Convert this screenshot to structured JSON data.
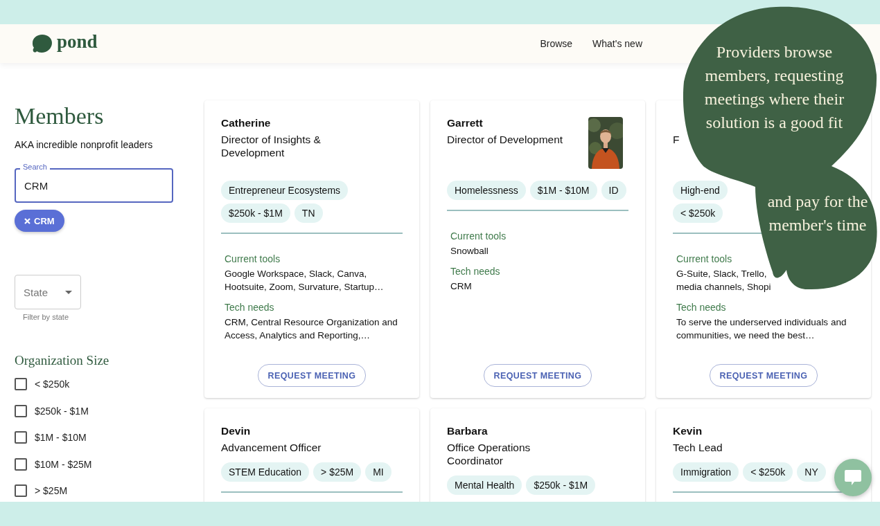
{
  "header": {
    "logo": "pond",
    "nav": [
      {
        "label": "Browse"
      },
      {
        "label": "What's new"
      }
    ]
  },
  "sidebar": {
    "title": "Members",
    "subtitle": "AKA incredible nonprofit leaders",
    "search": {
      "label": "Search",
      "value": "CRM"
    },
    "chips": [
      {
        "label": "CRM"
      }
    ],
    "state_filter": {
      "placeholder": "State",
      "helper": "Filter by state"
    },
    "org_size": {
      "title": "Organization Size",
      "options": [
        {
          "label": "< $250k",
          "checked": false
        },
        {
          "label": "$250k - $1M",
          "checked": false
        },
        {
          "label": "$1M - $10M",
          "checked": false
        },
        {
          "label": "$10M - $25M",
          "checked": false
        },
        {
          "label": "> $25M",
          "checked": false
        }
      ]
    }
  },
  "members": [
    {
      "name": "Catherine",
      "title": "Director of Insights & Development",
      "photo": false,
      "tag_rows": [
        [
          "Entrepreneur Ecosystems"
        ],
        [
          "$250k - $1M",
          "TN"
        ]
      ],
      "tools_label": "Current tools",
      "tools": "Google Workspace, Slack, Canva, Hootsuite, Zoom, Survature, Startup…",
      "needs_label": "Tech needs",
      "needs": "CRM, Central Resource Organization and Access, Analytics and Reporting,…",
      "button": "REQUEST MEETING"
    },
    {
      "name": "Garrett",
      "title": "Director of Development",
      "photo": true,
      "tag_rows": [
        [
          "Homelessness",
          "$1M - $10M",
          "ID"
        ]
      ],
      "tools_label": "Current tools",
      "tools": "Snowball",
      "needs_label": "Tech needs",
      "needs": "CRM",
      "button": "REQUEST MEETING"
    },
    {
      "title": "F",
      "photo": false,
      "tag_rows": [
        [
          "High-end"
        ],
        [
          "< $250k"
        ]
      ],
      "tools_label": "Current tools",
      "tools": "G-Suite, Slack, Trello,\nmedia channels, Shopi",
      "needs_label": "Tech needs",
      "needs": "To serve the underserved individuals and communities, we need the best…",
      "button": "REQUEST MEETING"
    },
    {
      "name": "Devin",
      "title": "Advancement Officer",
      "photo": false,
      "tag_rows": [
        [
          "STEM Education",
          "> $25M",
          "MI"
        ]
      ]
    },
    {
      "name": "Barbara",
      "title": "Office Operations Coordinator",
      "photo": false,
      "tag_rows": [
        [
          "Mental Health",
          "$250k - $1M"
        ]
      ]
    },
    {
      "name": "Kevin",
      "title": "Tech Lead",
      "photo": false,
      "tag_rows": [
        [
          "Immigration",
          "< $250k",
          "NY"
        ]
      ]
    }
  ],
  "callouts": [
    "Providers browse members, requesting meetings where their solution is a good fit",
    "and pay for the member's time"
  ]
}
